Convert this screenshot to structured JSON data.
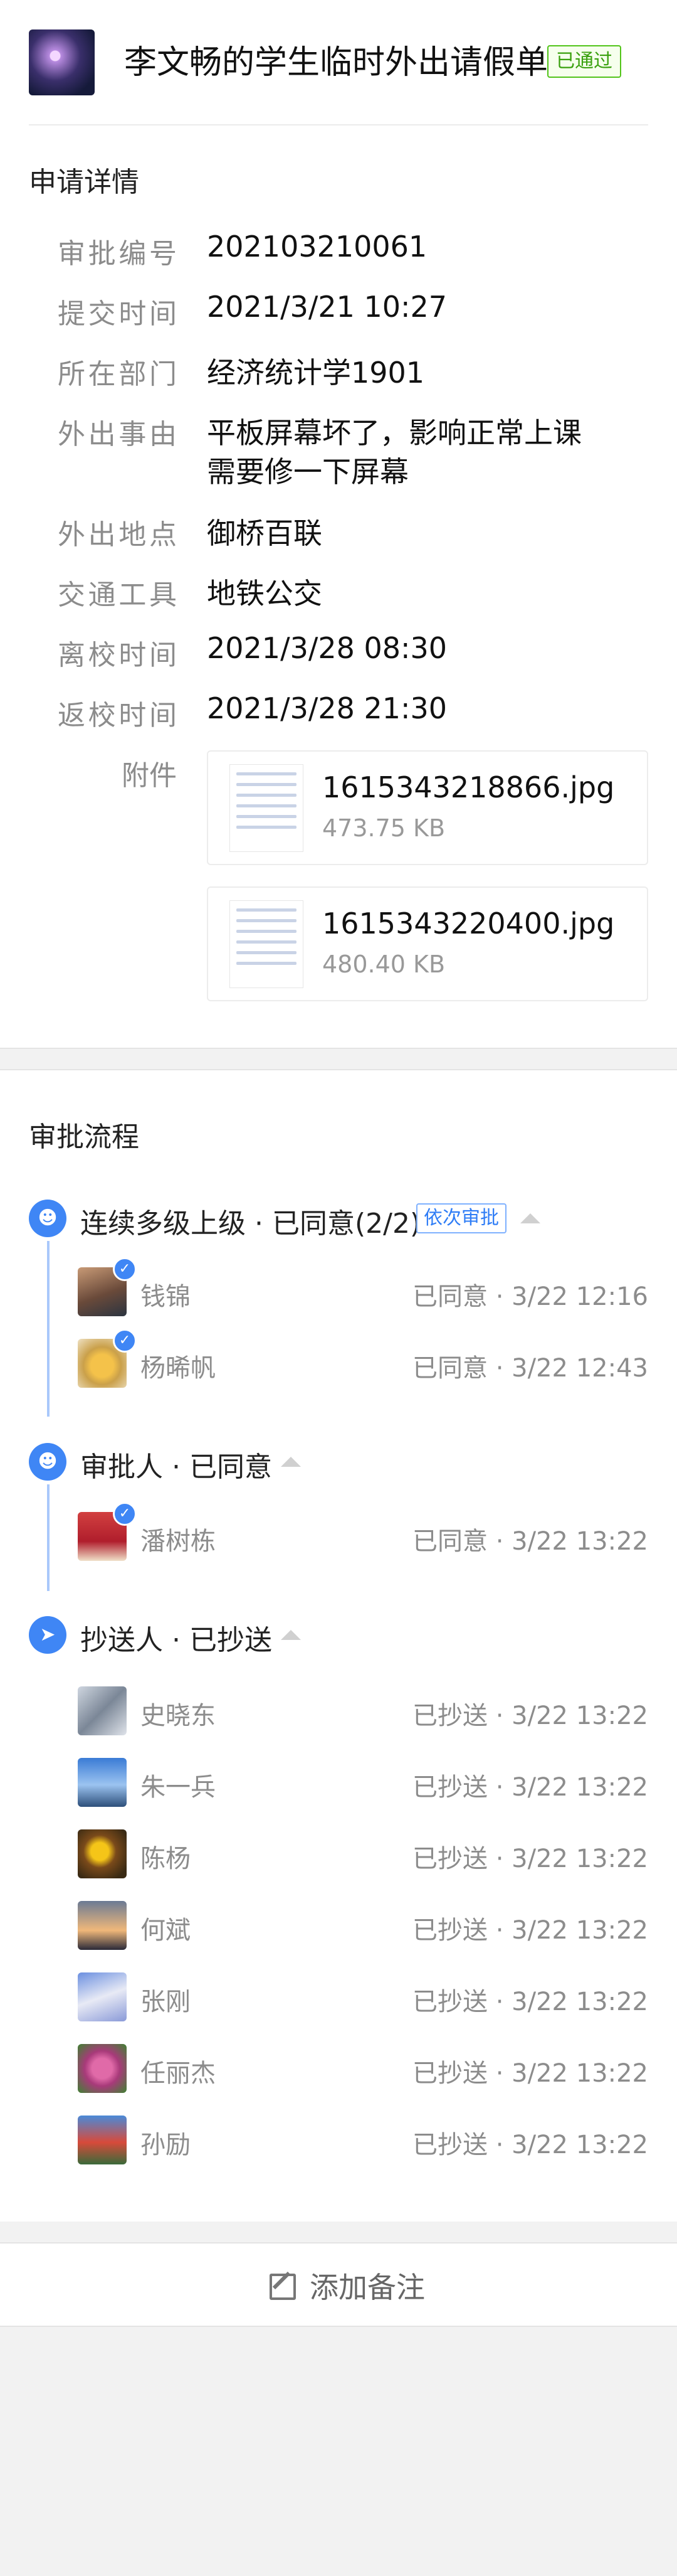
{
  "header": {
    "title": "李文畅的学生临时外出请假单",
    "status_badge": "已通过"
  },
  "details": {
    "section_title": "申请详情",
    "rows": [
      {
        "label": "审批编号",
        "value": "202103210061"
      },
      {
        "label": "提交时间",
        "value": "2021/3/21 10:27"
      },
      {
        "label": "所在部门",
        "value": "经济统计学1901"
      },
      {
        "label": "外出事由",
        "value": "平板屏幕坏了，影响正常上课",
        "value2": "需要修一下屏幕"
      },
      {
        "label": "外出地点",
        "value": "御桥百联"
      },
      {
        "label": "交通工具",
        "value": "地铁公交"
      },
      {
        "label": "离校时间",
        "value": "2021/3/28 08:30"
      },
      {
        "label": "返校时间",
        "value": "2021/3/28 21:30"
      }
    ],
    "attachment_label": "附件",
    "attachments": [
      {
        "name": "1615343218866.jpg",
        "size": "473.75 KB"
      },
      {
        "name": "1615343220400.jpg",
        "size": "480.40 KB"
      }
    ]
  },
  "flow": {
    "section_title": "审批流程",
    "nodes": [
      {
        "title": "连续多级上级 · 已同意(2/2)",
        "tag": "依次审批",
        "icon": "user-icon",
        "people": [
          {
            "name": "钱锦",
            "status": "已同意 · 3/22 12:16"
          },
          {
            "name": "杨晞帆",
            "status": "已同意 · 3/22 12:43"
          }
        ]
      },
      {
        "title": "审批人 · 已同意",
        "icon": "user-icon",
        "people": [
          {
            "name": "潘树栋",
            "status": "已同意 · 3/22 13:22"
          }
        ]
      },
      {
        "title": "抄送人 · 已抄送",
        "icon": "send-icon",
        "people": [
          {
            "name": "史晓东",
            "status": "已抄送 · 3/22 13:22"
          },
          {
            "name": "朱一兵",
            "status": "已抄送 · 3/22 13:22"
          },
          {
            "name": "陈杨",
            "status": "已抄送 · 3/22 13:22"
          },
          {
            "name": "何斌",
            "status": "已抄送 · 3/22 13:22"
          },
          {
            "name": "张刚",
            "status": "已抄送 · 3/22 13:22"
          },
          {
            "name": "任丽杰",
            "status": "已抄送 · 3/22 13:22"
          },
          {
            "name": "孙励",
            "status": "已抄送 · 3/22 13:22"
          }
        ]
      }
    ]
  },
  "footer": {
    "add_note_label": "添加备注"
  },
  "colors": {
    "accent": "#3f86f5",
    "approved_green": "#52c41a",
    "muted_text": "#8c8c8c"
  }
}
